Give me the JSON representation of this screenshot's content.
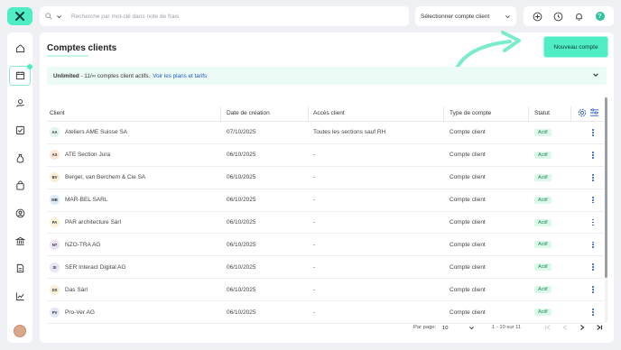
{
  "search": {
    "placeholder": "Recherche par mot-clé dans note de frais"
  },
  "client_select": {
    "label": "Sélectionner compte client"
  },
  "header_icons": [
    "plus-circle-icon",
    "clock-icon",
    "bell-icon",
    "help-icon"
  ],
  "help_label": "?",
  "sidebar": {
    "items": [
      {
        "icon": "home-icon"
      },
      {
        "icon": "calendar-icon",
        "active": true
      },
      {
        "icon": "money-hand-icon"
      },
      {
        "icon": "checkbox-icon"
      },
      {
        "icon": "money-bag-icon"
      },
      {
        "icon": "shopping-bag-icon"
      },
      {
        "icon": "user-circle-icon"
      },
      {
        "icon": "bank-icon"
      },
      {
        "icon": "document-icon"
      },
      {
        "icon": "chart-icon"
      }
    ]
  },
  "page": {
    "title": "Comptes clients",
    "new_button": "Nouveau compte"
  },
  "banner": {
    "plan": "Unlimited",
    "text": "- 11/∞ comptes client actifs.",
    "link": "Voir les plans et tarifs"
  },
  "table": {
    "headers": {
      "client": "Client",
      "date": "Date de création",
      "access": "Accès client",
      "type": "Type de compte",
      "status": "Statut"
    },
    "rows": [
      {
        "initials": "AA",
        "name": "Ateliers AME Suisse SA",
        "date": "07/10/2025",
        "access": "Toutes les sections sauf RH",
        "type": "Compte client",
        "status": "Actif",
        "color": "#dff5ec"
      },
      {
        "initials": "AS",
        "name": "ATE Section Jura",
        "date": "06/10/2025",
        "access": "-",
        "type": "Compte client",
        "status": "Actif",
        "color": "#fbe9d6"
      },
      {
        "initials": "BV",
        "name": "Berger, van Berchem & Cie SA",
        "date": "06/10/2025",
        "access": "-",
        "type": "Compte client",
        "status": "Actif",
        "color": "#f7eed4"
      },
      {
        "initials": "MB",
        "name": "MAR-BEL SARL",
        "date": "06/10/2025",
        "access": "-",
        "type": "Compte client",
        "status": "Actif",
        "color": "#dce9f8"
      },
      {
        "initials": "PA",
        "name": "PAR architecture Sàrl",
        "date": "06/10/2025",
        "access": "-",
        "type": "Compte client",
        "status": "Actif",
        "color": "#fbf1d4"
      },
      {
        "initials": "NT",
        "name": "NZO-TRA AG",
        "date": "06/10/2025",
        "access": "-",
        "type": "Compte client",
        "status": "Actif",
        "color": "#ece3f6"
      },
      {
        "initials": "SI",
        "name": "SER Interact Digital AG",
        "date": "06/10/2025",
        "access": "-",
        "type": "Compte client",
        "status": "Actif",
        "color": "#e6e4f7"
      },
      {
        "initials": "DS",
        "name": "Das Sàrl",
        "date": "06/10/2025",
        "access": "-",
        "type": "Compte client",
        "status": "Actif",
        "color": "#f7f0d6"
      },
      {
        "initials": "PV",
        "name": "Pro-Ver AG",
        "date": "06/10/2025",
        "access": "-",
        "type": "Compte client",
        "status": "Actif",
        "color": "#e3e6f7"
      }
    ]
  },
  "pagination": {
    "per_page_label": "Par page:",
    "per_page_value": "10",
    "range": "1 - 10 sur 11"
  }
}
